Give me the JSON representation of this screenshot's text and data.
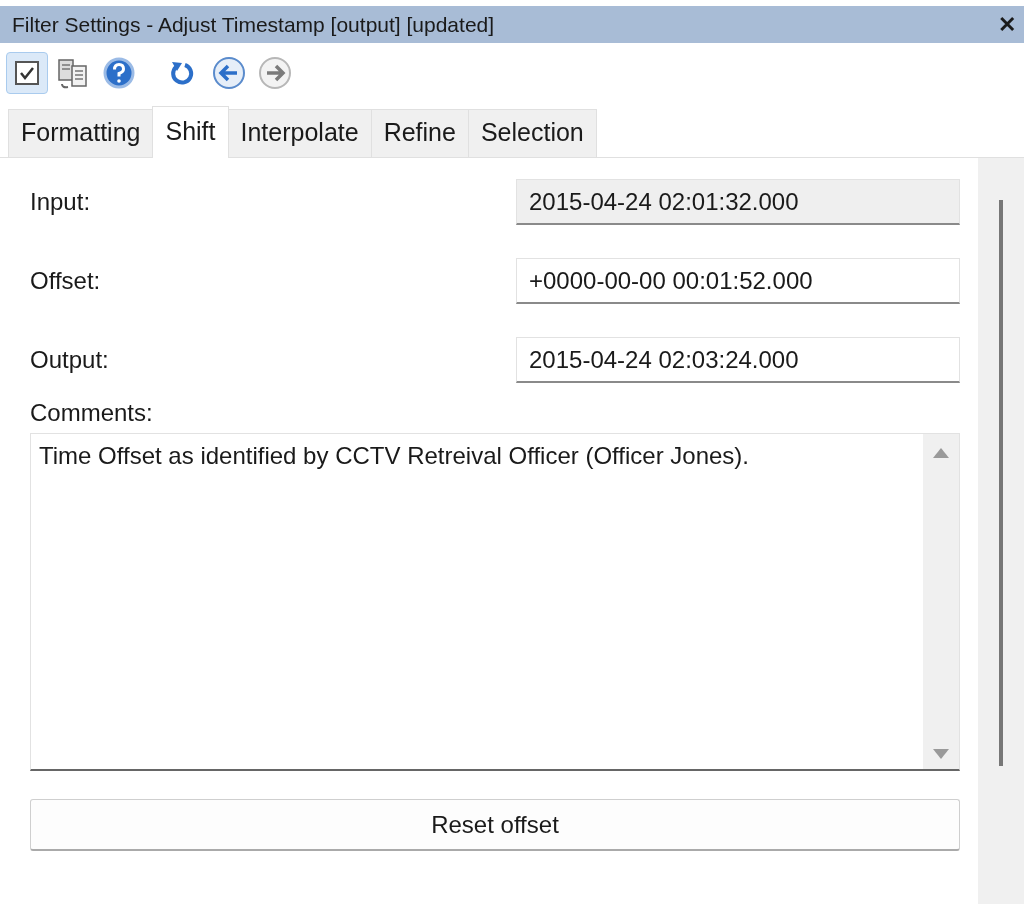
{
  "window": {
    "title": "Filter Settings - Adjust Timestamp [output] [updated]",
    "close": "✕"
  },
  "toolbar": [
    {
      "kind": "apply",
      "pressed": true,
      "disabled": false
    },
    {
      "kind": "copy",
      "pressed": false,
      "disabled": false
    },
    {
      "kind": "help",
      "pressed": false,
      "disabled": false
    },
    {
      "kind": "reset",
      "pressed": false,
      "disabled": false
    },
    {
      "kind": "back",
      "pressed": false,
      "disabled": false
    },
    {
      "kind": "forward",
      "pressed": false,
      "disabled": true
    }
  ],
  "tabs": [
    {
      "label": "Formatting",
      "selected": false
    },
    {
      "label": "Shift",
      "selected": true
    },
    {
      "label": "Interpolate",
      "selected": false
    },
    {
      "label": "Refine",
      "selected": false
    },
    {
      "label": "Selection",
      "selected": false
    }
  ],
  "fields": [
    {
      "label": "Input:",
      "value": "2015-04-24 02:01:32.000",
      "disabled": true
    },
    {
      "label": "Offset:",
      "value": "+0000-00-00 00:01:52.000",
      "disabled": false
    },
    {
      "label": "Output:",
      "value": "2015-04-24 02:03:24.000",
      "disabled": false
    }
  ],
  "comments": {
    "label": "Comments:",
    "value": "Time Offset as identified by CCTV Retreival Officer (Officer Jones)."
  },
  "buttons": [
    {
      "label": "Reset offset"
    }
  ]
}
